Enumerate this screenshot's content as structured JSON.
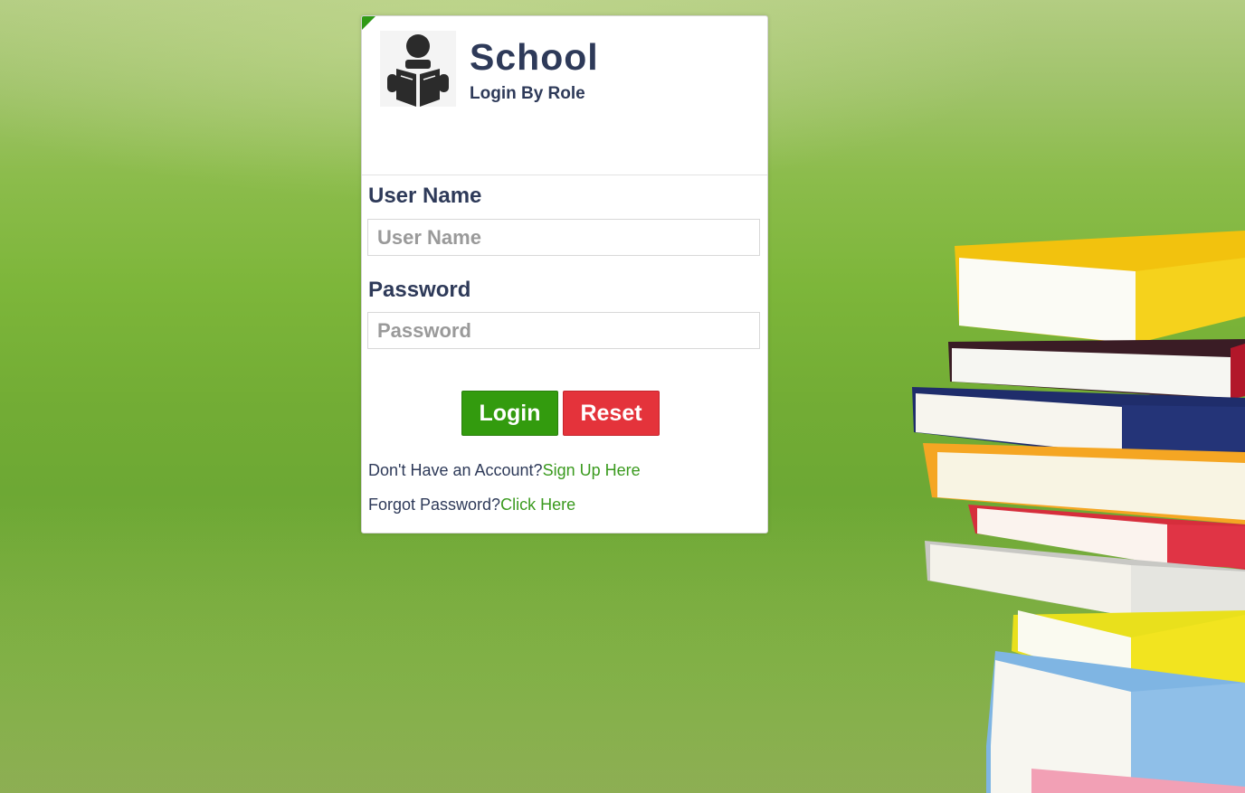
{
  "brand": {
    "title": "School",
    "subtitle": "Login By Role",
    "logo_icon": "reader-icon"
  },
  "form": {
    "username_label": "User Name",
    "username_placeholder": "User Name",
    "username_value": "",
    "password_label": "Password",
    "password_placeholder": "Password",
    "password_value": ""
  },
  "buttons": {
    "login": "Login",
    "reset": "Reset"
  },
  "links": {
    "signup_prompt": "Don't Have an Account?",
    "signup_link": "Sign Up Here",
    "forgot_prompt": "Forgot Password?",
    "forgot_link": "Click Here"
  },
  "colors": {
    "accent": "#339b0e",
    "danger": "#e4333b",
    "text": "#2e3a59",
    "link": "#3a9a1e"
  }
}
